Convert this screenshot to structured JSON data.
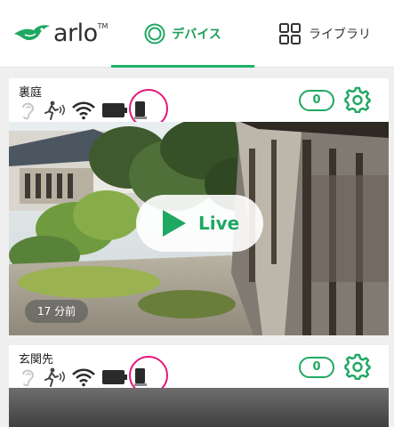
{
  "header": {
    "logo": {
      "text": "arlo",
      "tm": "TM"
    },
    "tabs": [
      {
        "label": "デバイス",
        "icon": "devices-ring-icon",
        "active": true
      },
      {
        "label": "ライブラリ",
        "icon": "grid-icon",
        "active": false
      }
    ]
  },
  "colors": {
    "accent": "#1fa862",
    "highlight": "#e4157c"
  },
  "devices": [
    {
      "name": "裏庭",
      "event_count": "0",
      "status_icons": [
        "sound-icon",
        "motion-icon",
        "wifi-icon",
        "battery-icon",
        "camera-device-icon"
      ],
      "live_label": "Live",
      "last_event": "17 分前"
    },
    {
      "name": "玄関先",
      "event_count": "0",
      "status_icons": [
        "sound-icon",
        "motion-icon",
        "wifi-icon",
        "battery-icon",
        "camera-device-icon"
      ]
    }
  ]
}
